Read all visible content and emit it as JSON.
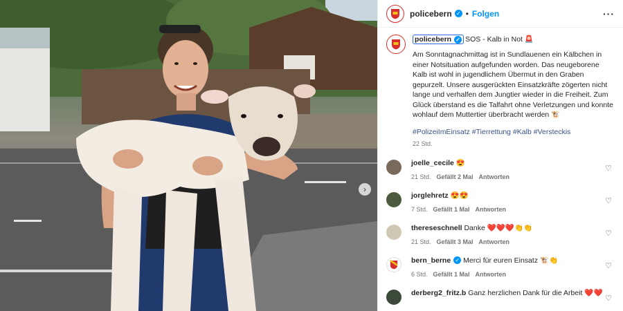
{
  "post": {
    "username": "policebern",
    "follow_label": "Folgen",
    "more_icon": "more-horizontal-icon",
    "avatar_text": "POLICE",
    "caption_title": "SOS - Kalb in Not 🚨",
    "caption_text": "Am Sonntagnachmittag ist in Sundlauenen ein Kälbchen in einer Notsituation aufgefunden worden. Das neugeborene Kalb ist wohl in jugendlichem Übermut in den Graben gepurzelt. Unsere ausgerückten Einsatzkräfte zögerten nicht lange und verhalfen dem Jungtier wieder in die Freiheit. Zum Glück überstand es die Talfahrt ohne Verletzungen und konnte wohlauf dem Muttertier überbracht werden 🐮",
    "hashtags": [
      "#PolizeiImEinsatz",
      "#Tierrettung",
      "#Kalb",
      "#Versteckis"
    ],
    "time": "22 Std."
  },
  "comments": [
    {
      "user": "joelle_cecile",
      "text": "😍",
      "time": "21 Std.",
      "likes": "Gefällt 2 Mal",
      "reply": "Antworten",
      "verified": false,
      "avatar_color": "#7a6a5c"
    },
    {
      "user": "jorglehretz",
      "text": "😍😍",
      "time": "7 Std.",
      "likes": "Gefällt 1 Mal",
      "reply": "Antworten",
      "verified": false,
      "avatar_color": "#4b5a3c"
    },
    {
      "user": "thereseschnell",
      "text": "Danke ❤️❤️❤️👏👏",
      "time": "21 Std.",
      "likes": "Gefällt 3 Mal",
      "reply": "Antworten",
      "verified": false,
      "avatar_color": "#cfc8b4"
    },
    {
      "user": "bern_berne",
      "text": "Merci für euren Einsatz 🐮👏",
      "time": "6 Std.",
      "likes": "Gefällt 1 Mal",
      "reply": "Antworten",
      "verified": true,
      "avatar_color": "#ffffff"
    },
    {
      "user": "derberg2_fritz.b",
      "text": "Ganz herzlichen Dank für die Arbeit ❤️❤️",
      "time": "",
      "likes": "",
      "reply": "",
      "verified": false,
      "avatar_color": "#3c4a3a"
    }
  ],
  "colors": {
    "accent": "#0095f6",
    "brand_red": "#d62d2d"
  }
}
